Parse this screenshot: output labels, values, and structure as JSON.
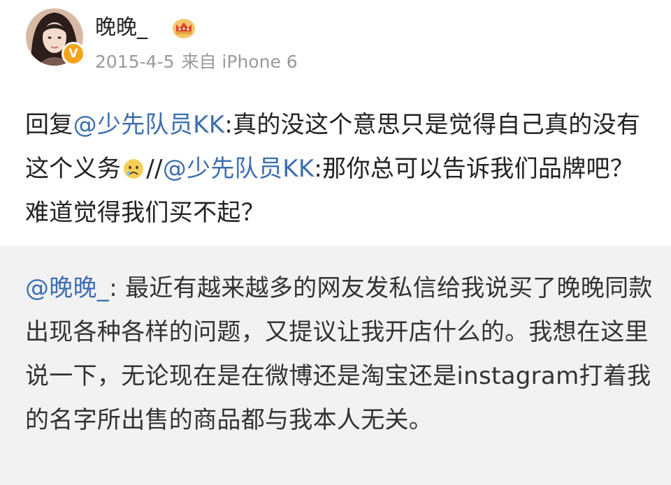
{
  "post": {
    "username": "晚晚_",
    "date": "2015-4-5",
    "source": "来自 iPhone 6",
    "verified_mark": "V",
    "avatar_icon": "user-avatar-icon",
    "member_icon": "crown-icon",
    "text": {
      "reply_prefix": "回复",
      "mention_1": "@少先队员KK",
      "reply_text": ":真的没这个意思只是觉得自己真的没有这个义务",
      "emoji": "sad-face-icon",
      "repost_sep": "//",
      "mention_2": "@少先队员KK",
      "quoted_text": ":那你总可以告诉我们品牌吧？难道觉得我们买不起？"
    }
  },
  "repost": {
    "mention": "@晚晚_",
    "text": ": 最近有越来越多的网友发私信给我说买了晚晚同款出现各种各样的问题，又提议让我开店什么的。我想在这里说一下，无论现在是在微博还是淘宝还是instagram打着我的名字所出售的商品都与我本人无关。"
  },
  "colors": {
    "link": "#3d6fb0",
    "meta": "#9a9a9a",
    "text": "#222222",
    "repost_bg": "#f2f2f2",
    "badge": "#f2a51a"
  }
}
